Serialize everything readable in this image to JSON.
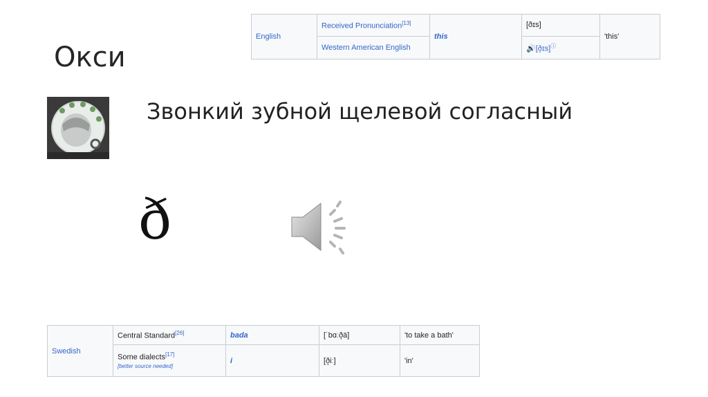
{
  "slide": {
    "title": "Окси",
    "subtitle": "Звонкий зубной щелевой согласный",
    "letter": "ð"
  },
  "table_top": {
    "language": "English",
    "dialect_1": "Received Pronunciation",
    "dialect_1_ref": "[13]",
    "dialect_2": "Western American English",
    "word": "this",
    "ipa_1": "[ðɪs]",
    "ipa_2_icon": "🔊",
    "ipa_2": "[ð̞ɪs]",
    "ipa_2_ref": "ⓘ",
    "gloss": "'this'"
  },
  "table_bottom": {
    "language": "Swedish",
    "dialect_1": "Central Standard",
    "dialect_1_ref": "[26]",
    "word_1": "bada",
    "ipa_1": "[ˈbɑːð̞ä]",
    "gloss_1": "'to take a bath'",
    "dialect_2": "Some dialects",
    "dialect_2_ref": "[17]",
    "dialect_2_note": "[better source needed]",
    "word_2": "i",
    "ipa_2": "[ð̞iː]",
    "gloss_2": "'in'"
  },
  "icons": {
    "avatar": "avatar-image",
    "speaker": "speaker-icon"
  }
}
